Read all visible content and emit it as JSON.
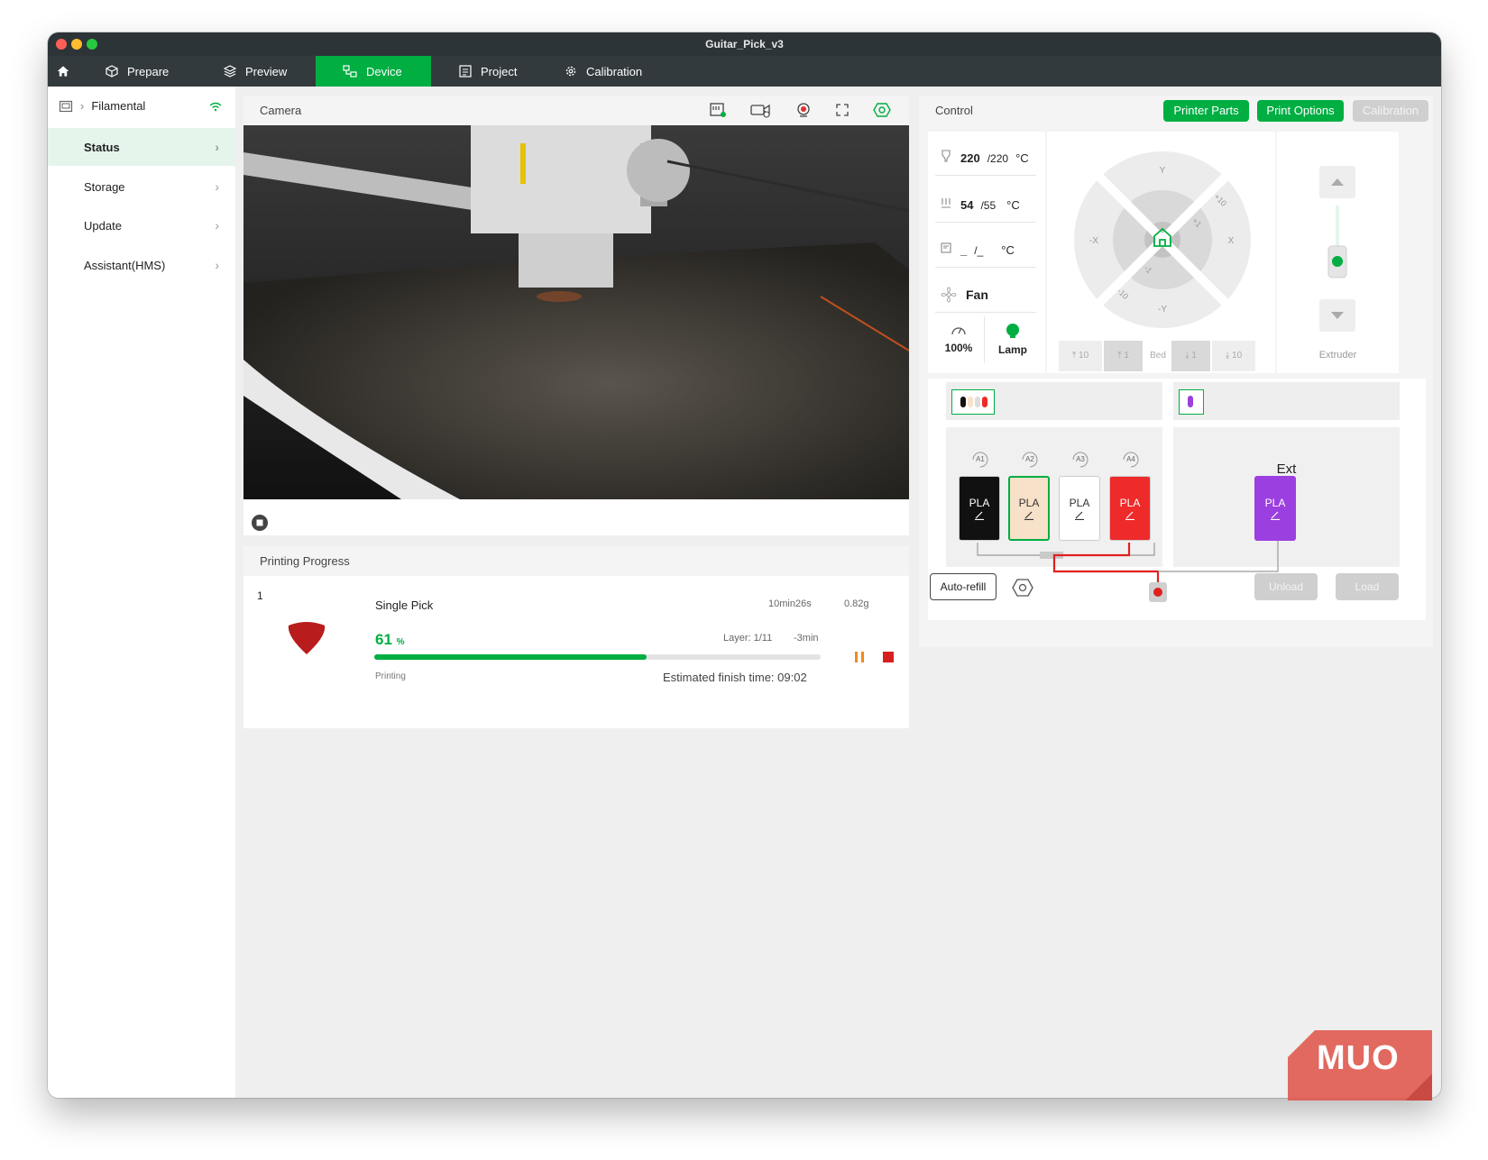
{
  "window": {
    "title": "Guitar_Pick_v3"
  },
  "nav": {
    "tabs": [
      {
        "label": "Prepare"
      },
      {
        "label": "Preview"
      },
      {
        "label": "Device"
      },
      {
        "label": "Project"
      },
      {
        "label": "Calibration"
      }
    ],
    "active_tab": "Device"
  },
  "sidebar": {
    "printer_name": "Filamental",
    "items": [
      {
        "label": "Status"
      },
      {
        "label": "Storage"
      },
      {
        "label": "Update"
      },
      {
        "label": "Assistant(HMS)"
      }
    ]
  },
  "camera": {
    "title": "Camera"
  },
  "progress": {
    "title": "Printing Progress",
    "plate": "1",
    "job_name": "Single Pick",
    "duration": "10min26s",
    "weight": "0.82g",
    "percent_value": "61",
    "percent_unit": "%",
    "percent_fraction": 0.61,
    "layer": "Layer: 1/11",
    "remaining": "-3min",
    "state": "Printing",
    "eta": "Estimated finish time: 09:02"
  },
  "control": {
    "title": "Control",
    "buttons": {
      "printer_parts": "Printer Parts",
      "print_options": "Print Options",
      "calibration": "Calibration"
    },
    "nozzle": {
      "current": "220",
      "target": "/220",
      "unit": "°C"
    },
    "bed": {
      "current": "54",
      "target": "/55",
      "unit": "°C"
    },
    "chamber": {
      "current": "_",
      "target": "/_",
      "unit": "°C"
    },
    "fan_label": "Fan",
    "speed_label": "100%",
    "lamp_label": "Lamp",
    "jog": {
      "y_plus": "Y",
      "y_minus": "-Y",
      "x_plus": "X",
      "x_minus": "-X",
      "plus10": "+10",
      "plus1": "+1",
      "minus1": "-1",
      "minus10": "-10"
    },
    "bed_buttons": {
      "up10": "10",
      "up1": "1",
      "label": "Bed",
      "down1": "1",
      "down10": "10"
    },
    "extruder_label": "Extruder"
  },
  "ams": {
    "slots": [
      {
        "id": "A1",
        "material": "PLA",
        "color": "#111111",
        "text_color": "#ffffff"
      },
      {
        "id": "A2",
        "material": "PLA",
        "color": "#f7e1c9",
        "text_color": "#333333"
      },
      {
        "id": "A3",
        "material": "PLA",
        "color": "#ffffff",
        "text_color": "#333333"
      },
      {
        "id": "A4",
        "material": "PLA",
        "color": "#ee2a2a",
        "text_color": "#ffffff"
      }
    ],
    "ext": {
      "label": "Ext",
      "material": "PLA",
      "color": "#9b3fe0"
    },
    "auto_refill": "Auto-refill",
    "unload": "Unload",
    "load": "Load"
  },
  "watermark": "MUO",
  "colors": {
    "accent": "#00ae42",
    "titlebar": "#2c3438",
    "menubar": "#323a3d"
  }
}
